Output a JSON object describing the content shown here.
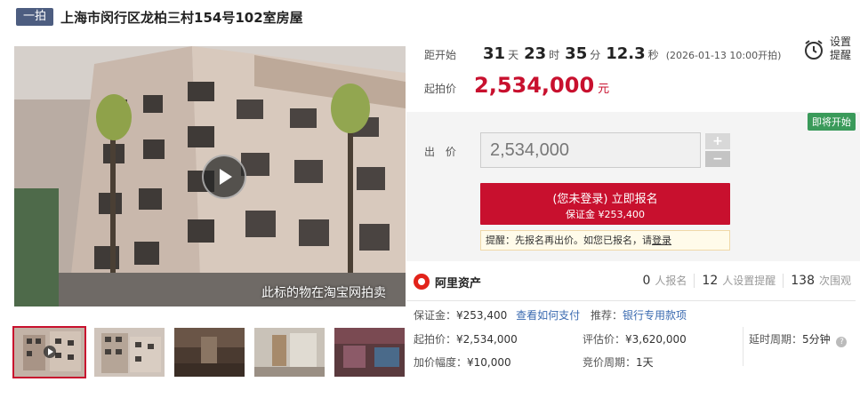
{
  "header": {
    "badge": "一拍",
    "title": "上海市闵行区龙柏三村154号102室房屋"
  },
  "media": {
    "caption": "此标的物在淘宝网拍卖",
    "thumbnails": [
      "thumb-1",
      "thumb-2",
      "thumb-3",
      "thumb-4",
      "thumb-5"
    ],
    "active_thumbnail": 0
  },
  "countdown": {
    "label": "距开始",
    "days": "31",
    "days_unit": "天",
    "hours": "23",
    "hours_unit": "时",
    "minutes": "35",
    "minutes_unit": "分",
    "seconds": "12.3",
    "seconds_unit": "秒",
    "start_note": "(2026-01-13 10:00开拍)"
  },
  "reminder": {
    "line1": "设置",
    "line2": "提醒",
    "icon": "alarm-clock-icon"
  },
  "start_price": {
    "label": "起拍价",
    "value": "2,534,000",
    "unit": "元"
  },
  "bid": {
    "status_tag": "即将开始",
    "label": "出 价",
    "input_value": "2,534,000",
    "plus": "+",
    "minus": "−",
    "signup_line1": "(您未登录) 立即报名",
    "signup_line2": "保证金 ¥253,400",
    "hint_prefix": "提醒：先报名再出价。如您已报名，请",
    "hint_link": "登录"
  },
  "brand": {
    "name": "阿里资产"
  },
  "stats": [
    {
      "num": "0",
      "label": "人报名"
    },
    {
      "num": "12",
      "label": "人设置提醒"
    },
    {
      "num": "138",
      "label": "次围观"
    }
  ],
  "details": {
    "deposit_label": "保证金：",
    "deposit_value": "¥253,400",
    "deposit_link": "查看如何支付",
    "recommend_label": "推荐：",
    "recommend_link": "银行专用款项",
    "start_label": "起拍价：",
    "start_value": "¥2,534,000",
    "assess_label": "评估价：",
    "assess_value": "¥3,620,000",
    "delay_label": "延时周期：",
    "delay_value": "5分钟",
    "increment_label": "加价幅度：",
    "increment_value": "¥10,000",
    "cycle_label": "竞价周期：",
    "cycle_value": "1天"
  },
  "colors": {
    "accent": "#c8102e",
    "badge": "#4d5d80",
    "status": "#3a9a5a",
    "link": "#3a6ab0"
  }
}
